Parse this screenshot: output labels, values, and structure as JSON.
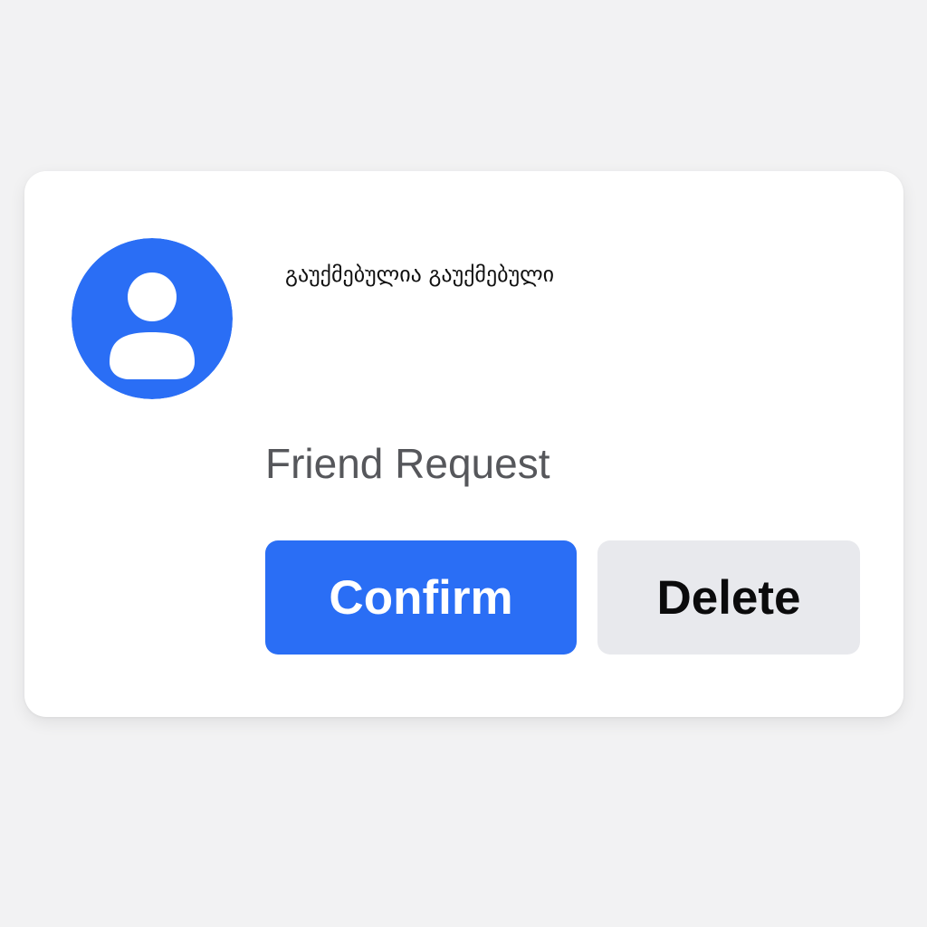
{
  "card": {
    "user_name": "გაუქმებულია გაუქმებული",
    "subtitle": "Friend Request",
    "avatar_icon": "user-avatar-icon",
    "confirm_label": "Confirm",
    "delete_label": "Delete"
  },
  "colors": {
    "background": "#f2f2f3",
    "accent": "#2a6ef5",
    "secondary_button": "#e8e9ed"
  }
}
